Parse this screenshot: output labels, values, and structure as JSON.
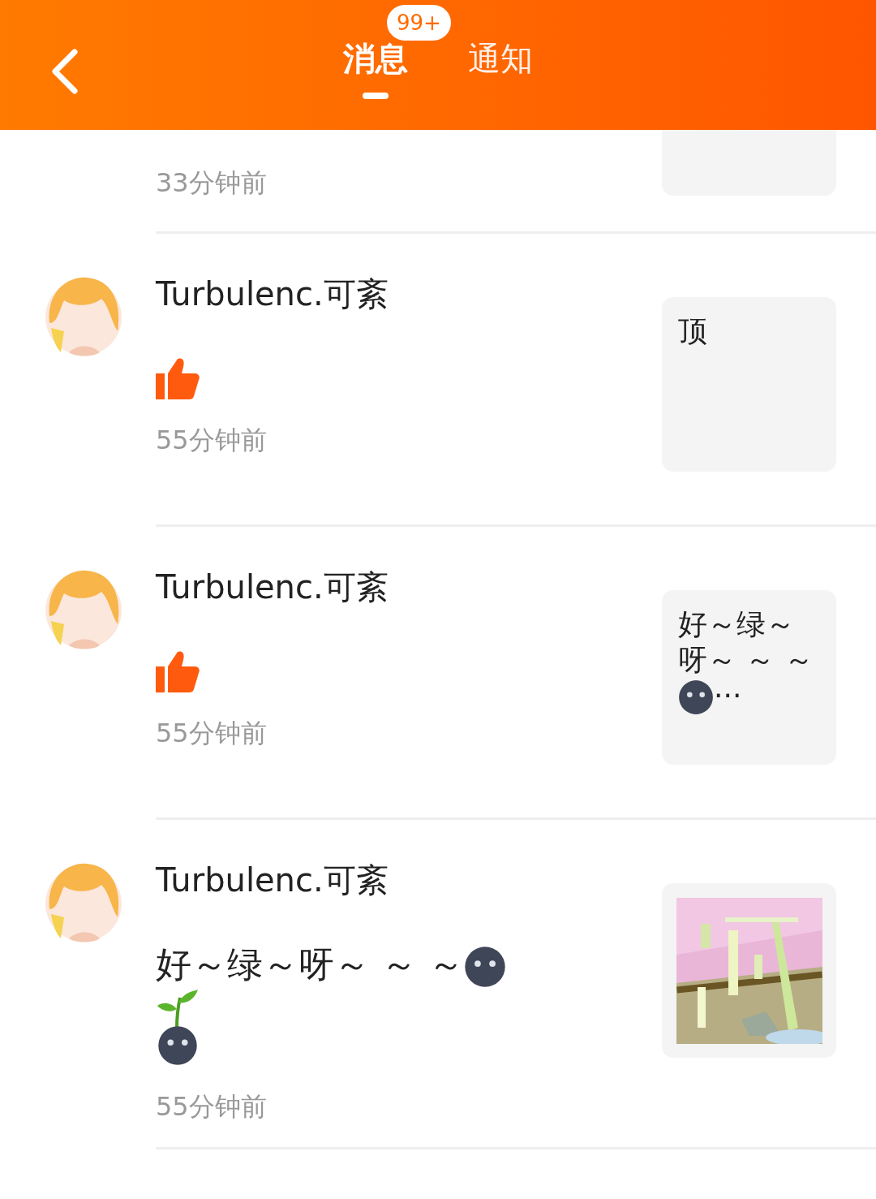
{
  "header": {
    "tabs": [
      {
        "label": "消息",
        "selected": true,
        "badge": "99+"
      },
      {
        "label": "通知",
        "selected": false
      }
    ]
  },
  "rows": [
    {
      "partial": true,
      "time": "33分钟前"
    },
    {
      "name": "Turbulenc.可紊",
      "message": [
        {
          "kind": "like"
        }
      ],
      "time": "55分钟前",
      "preview": {
        "kind": "text",
        "parts": [
          {
            "kind": "text",
            "text": "顶"
          }
        ]
      }
    },
    {
      "name": "Turbulenc.可紊",
      "message": [
        {
          "kind": "like"
        }
      ],
      "time": "55分钟前",
      "preview": {
        "kind": "text",
        "parts": [
          {
            "kind": "text",
            "text": "好～绿～呀～ ～ ～"
          },
          {
            "kind": "moon"
          },
          {
            "kind": "text",
            "text": "···"
          }
        ]
      }
    },
    {
      "name": "Turbulenc.可紊",
      "message": [
        {
          "kind": "text",
          "text": "好～绿～呀～ ～ ～"
        },
        {
          "kind": "moon"
        },
        {
          "kind": "sprout_moon"
        }
      ],
      "time": "55分钟前",
      "preview": {
        "kind": "picture"
      }
    }
  ]
}
